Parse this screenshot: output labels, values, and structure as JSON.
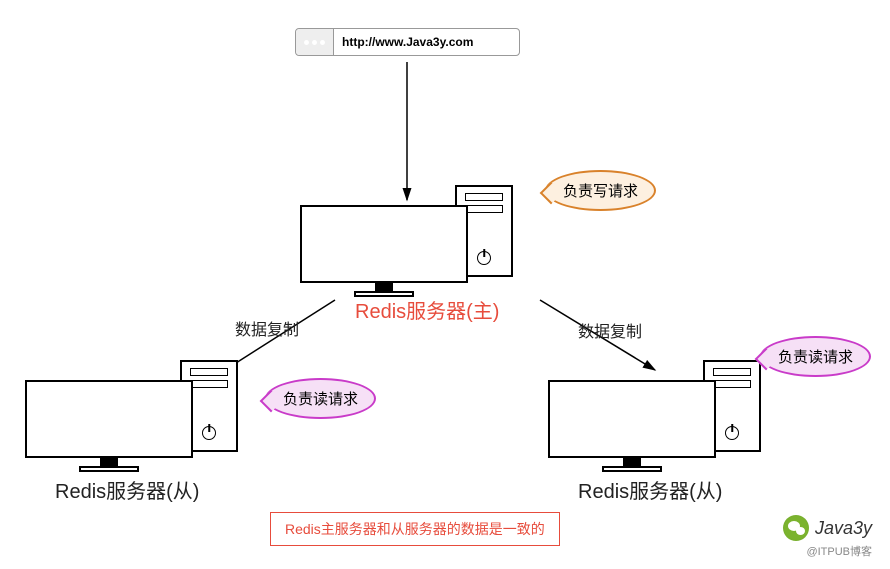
{
  "url": "http://www.Java3y.com",
  "nodes": {
    "master": {
      "label": "Redis服务器(主)",
      "bubble": "负责写请求"
    },
    "slave_left": {
      "label": "Redis服务器(从)",
      "bubble": "负责读请求"
    },
    "slave_right": {
      "label": "Redis服务器(从)",
      "bubble": "负责读请求"
    }
  },
  "edges": {
    "to_slave_left": "数据复制",
    "to_slave_right": "数据复制"
  },
  "note": "Redis主服务器和从服务器的数据是一致的",
  "watermark": {
    "name": "Java3y",
    "source": "@ITPUB博客"
  }
}
